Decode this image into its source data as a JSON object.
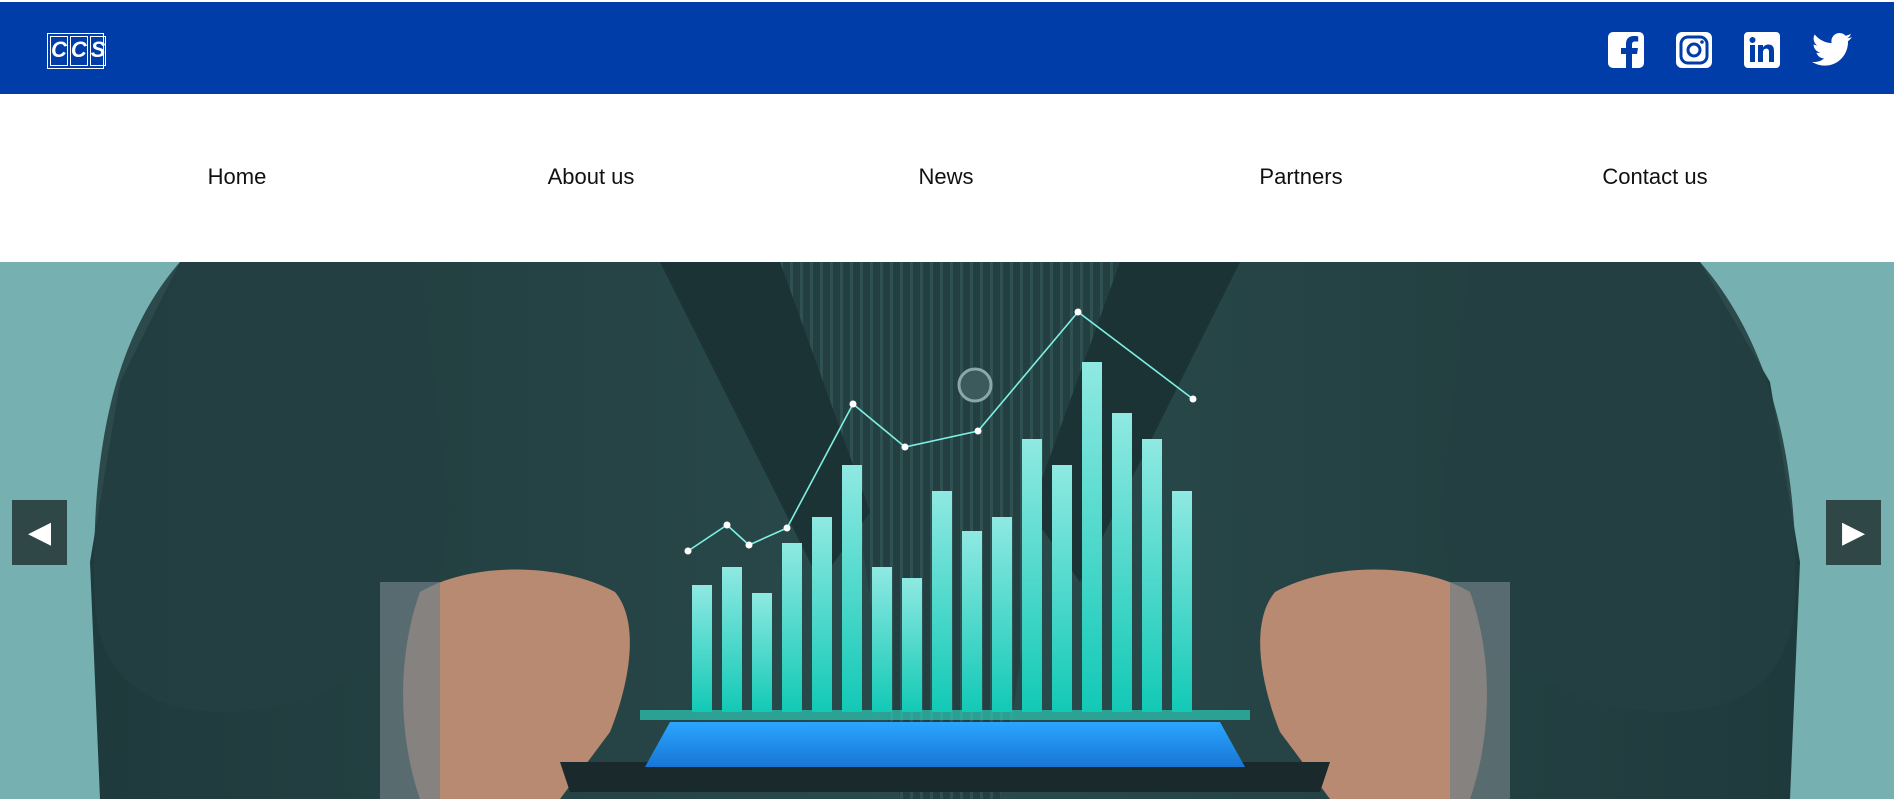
{
  "header": {
    "logo_letters": [
      "C",
      "C",
      "S"
    ],
    "background_color": "#003DA9",
    "social_icons": [
      "facebook-icon",
      "instagram-icon",
      "linkedin-icon",
      "twitter-icon"
    ]
  },
  "nav": {
    "items": [
      {
        "label": "Home"
      },
      {
        "label": "About us"
      },
      {
        "label": "News"
      },
      {
        "label": "Partners"
      },
      {
        "label": "Contact us"
      }
    ]
  },
  "hero": {
    "background_color": "#77b0b0",
    "prev_arrow": "◀",
    "next_arrow": "▶",
    "illustration": "businessman-holding-tablet-with-holographic-bar-chart",
    "accent_color": "#2fe0c8"
  }
}
